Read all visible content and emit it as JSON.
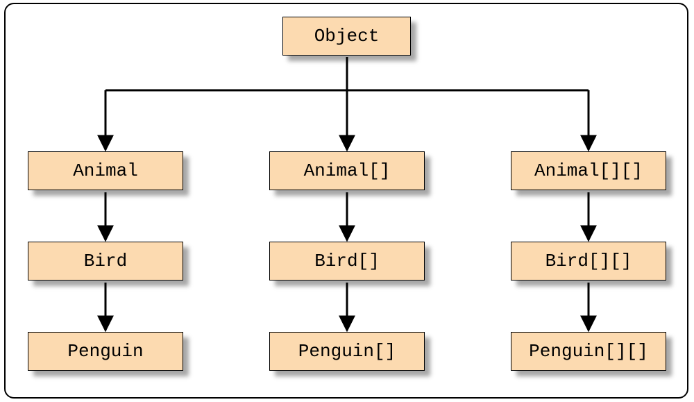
{
  "diagram": {
    "root": {
      "label": "Object"
    },
    "columns": [
      {
        "animal": "Animal",
        "bird": "Bird",
        "penguin": "Penguin"
      },
      {
        "animal": "Animal[]",
        "bird": "Bird[]",
        "penguin": "Penguin[]"
      },
      {
        "animal": "Animal[][]",
        "bird": "Bird[][]",
        "penguin": "Penguin[][]"
      }
    ]
  },
  "colors": {
    "node_fill": "#fcdab0",
    "border": "#000000",
    "background": "#ffffff"
  }
}
